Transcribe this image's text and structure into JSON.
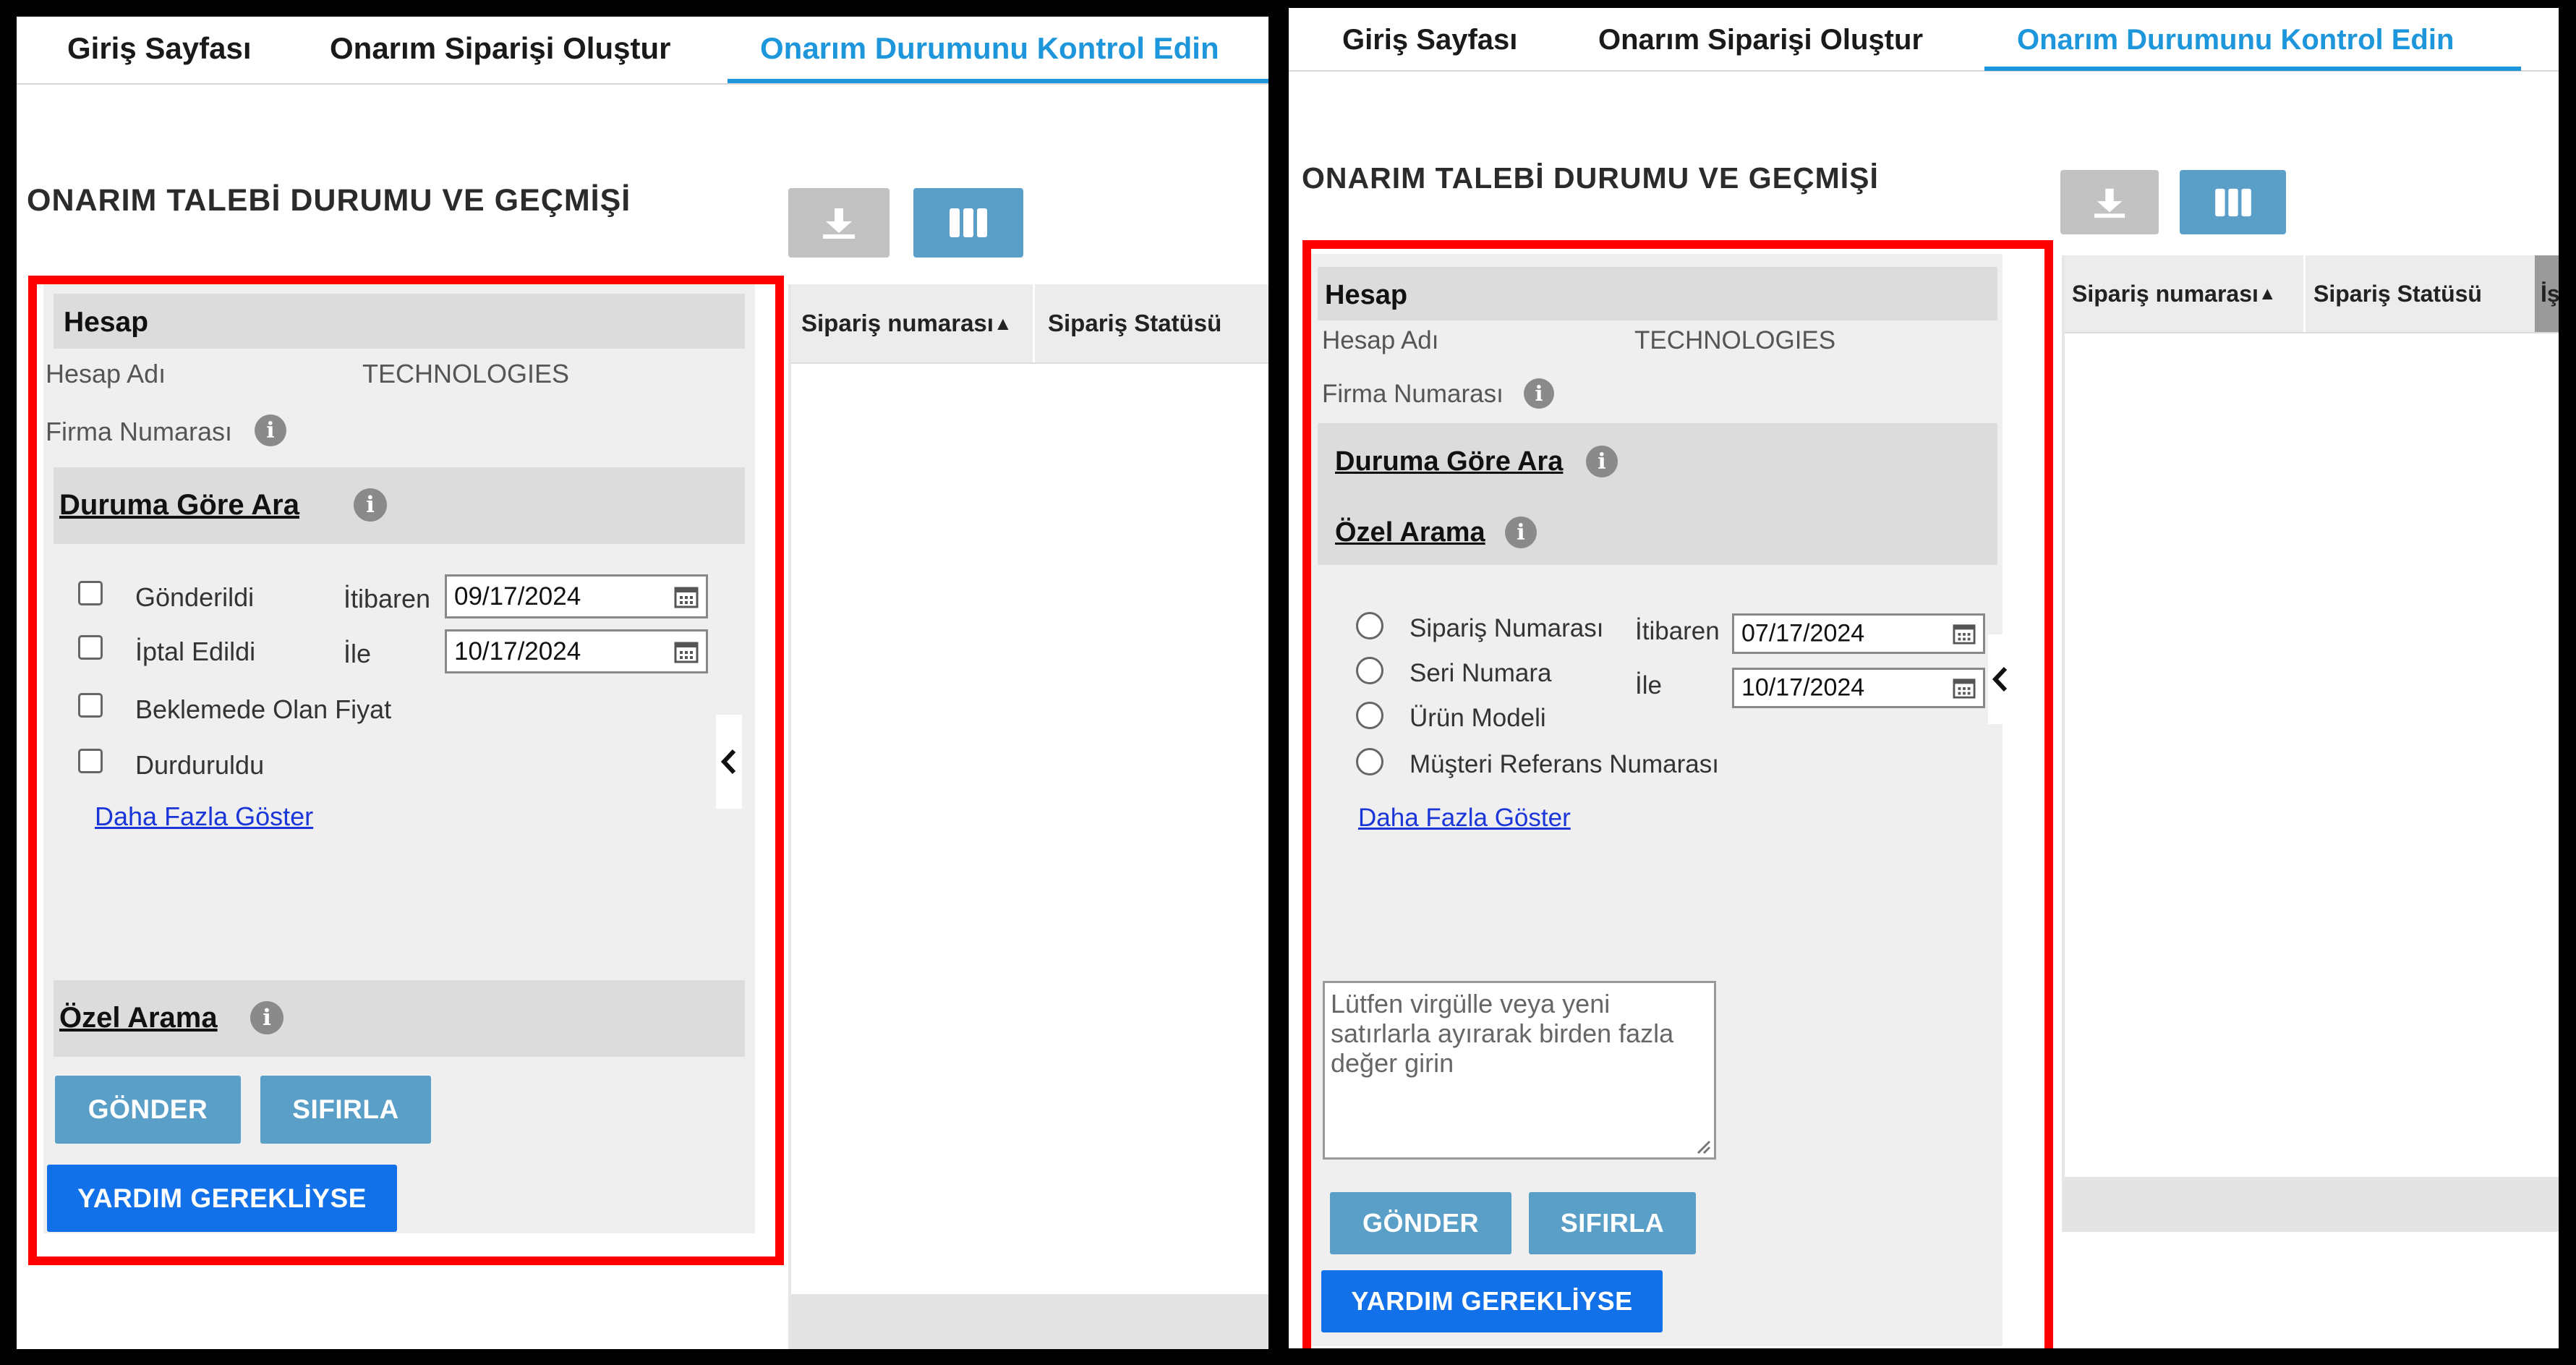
{
  "tabs": [
    "Giriş Sayfası",
    "Onarım Siparişi Oluştur",
    "Onarım Durumunu Kontrol Edin"
  ],
  "page_title": "ONARIM TALEBİ DURUMU VE GEÇMİŞİ",
  "grid": {
    "col_order": "Sipariş numarası",
    "col_status": "Sipariş Statüsü",
    "col_extra": "İş",
    "sort_indicator": "▲"
  },
  "account": {
    "section": "Hesap",
    "name_label": "Hesap Adı",
    "name_value": "TECHNOLOGIES",
    "firm_label": "Firma Numarası"
  },
  "status_search": {
    "title": "Duruma Göre Ara",
    "statuses": [
      "Gönderildi",
      "İptal Edildi",
      "Beklemede Olan Fiyat",
      "Durduruldu"
    ],
    "from_label": "İtibaren",
    "to_label": "İle",
    "from_date": "09/17/2024",
    "to_date": "10/17/2024",
    "more_link": "Daha Fazla Göster"
  },
  "custom_search": {
    "title": "Özel Arama",
    "options": [
      "Sipariş Numarası",
      "Seri Numara",
      "Ürün Modeli",
      "Müşteri Referans Numarası"
    ],
    "from_label": "İtibaren",
    "to_label": "İle",
    "from_date": "07/17/2024",
    "to_date": "10/17/2024",
    "more_link": "Daha Fazla Göster",
    "textarea_placeholder": "Lütfen virgülle veya yeni satırlarla ayırarak birden fazla değer girin"
  },
  "buttons": {
    "submit": "GÖNDER",
    "reset": "SIFIRLA",
    "help": "YARDIM GEREKLİYSE"
  },
  "icons": [
    "download-icon",
    "columns-icon",
    "info-icon",
    "calendar-icon",
    "chevron-left-icon",
    "resize-grip-icon"
  ],
  "colors": {
    "active_tab": "#1e96dc",
    "highlight": "#ff0000",
    "primary_button": "#1271e8",
    "secondary_button": "#5a9fc8"
  }
}
